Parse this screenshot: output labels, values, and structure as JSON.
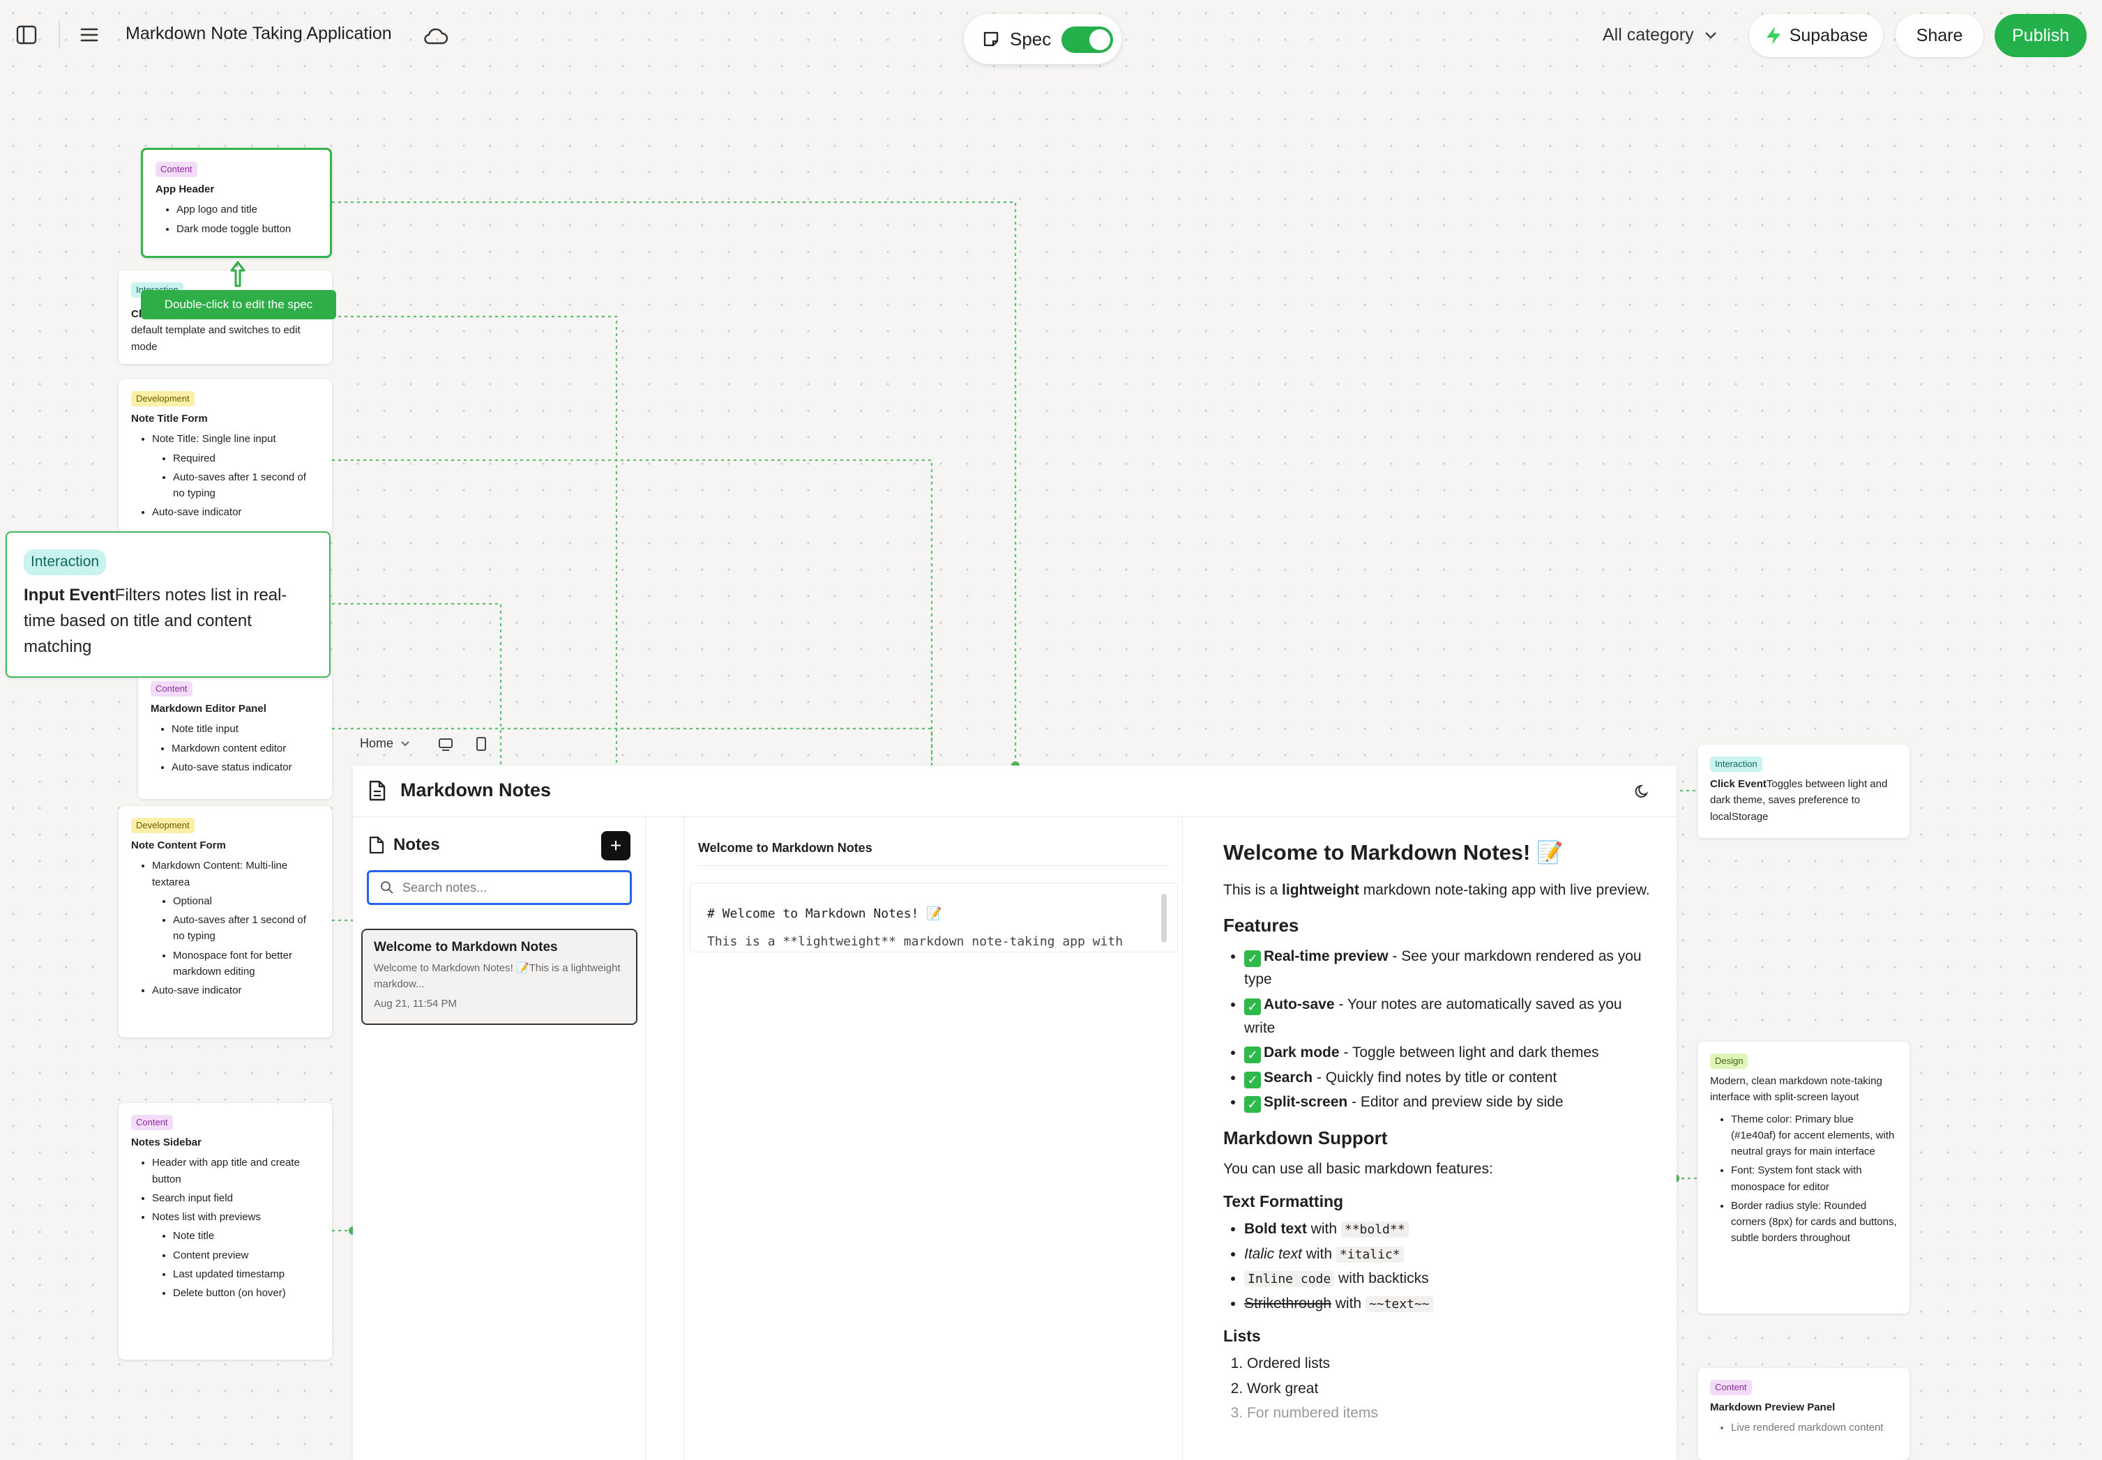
{
  "topbar": {
    "sidebar_toggle_icon": "sidebar-icon",
    "menu_icon": "hamburger-icon",
    "title": "Markdown Note Taking Application",
    "cloud_icon": "cloud-icon",
    "spec_label": "Spec",
    "spec_on": true,
    "category": "All category",
    "supabase": "Supabase",
    "share": "Share",
    "publish": "Publish",
    "accent": "#24b14b"
  },
  "tooltip": "Double-click to edit the spec",
  "cards": {
    "app_header": {
      "tag": "Content",
      "title": "App Header",
      "items": [
        "App logo and title",
        "Dark mode toggle button"
      ]
    },
    "click_template": {
      "tag": "Interaction",
      "title_start": "Cl",
      "text": "default template and switches to edit mode"
    },
    "note_title_form": {
      "tag": "Development",
      "title": "Note Title Form",
      "item1": "Note Title: Single line input",
      "sub1": "Required",
      "sub2": "Auto-saves after 1 second of no typing",
      "item2": "Auto-save indicator"
    },
    "input_event": {
      "tag": "Interaction",
      "bold": "Input Event",
      "text": "Filters notes list in real-time based on title and content matching"
    },
    "editor_panel": {
      "tag": "Content",
      "title": "Markdown Editor Panel",
      "items": [
        "Note title input",
        "Markdown content editor",
        "Auto-save status indicator"
      ]
    },
    "note_content_form": {
      "tag": "Development",
      "title": "Note Content Form",
      "item1": "Markdown Content: Multi-line textarea",
      "sub1": "Optional",
      "sub2": "Auto-saves after 1 second of no typing",
      "sub3": "Monospace font for better markdown editing",
      "item2": "Auto-save indicator"
    },
    "notes_sidebar": {
      "tag": "Content",
      "title": "Notes Sidebar",
      "item1": "Header with app title and create button",
      "item2": "Search input field",
      "item3": "Notes list with previews",
      "sub1": "Note title",
      "sub2": "Content preview",
      "sub3": "Last updated timestamp",
      "sub4": "Delete button (on hover)"
    },
    "dark_toggle": {
      "tag": "Interaction",
      "bold": "Click Event",
      "text": "Toggles between light and dark theme, saves preference to localStorage"
    },
    "design": {
      "tag": "Design",
      "text": "Modern, clean markdown note-taking interface with split-screen layout",
      "items": [
        "Theme color: Primary blue (#1e40af) for accent elements, with neutral grays for main interface",
        "Font: System font stack with monospace for editor",
        "Border radius style: Rounded corners (8px) for cards and buttons, subtle borders throughout"
      ]
    },
    "preview_panel": {
      "tag": "Content",
      "title": "Markdown Preview Panel",
      "item1": "Live rendered markdown content"
    }
  },
  "preview_toolbar": {
    "page": "Home",
    "desktop_icon": "monitor-icon",
    "mobile_icon": "phone-icon"
  },
  "app": {
    "title": "Markdown Notes",
    "doc_icon": "document-icon",
    "theme_icon": "moon-icon",
    "sidebar_title": "Notes",
    "search_placeholder": "Search notes...",
    "note": {
      "title": "Welcome to Markdown Notes",
      "preview": "Welcome to Markdown Notes! 📝This is a lightweight markdow...",
      "date": "Aug 21, 11:54 PM"
    },
    "editor_title": "Welcome to Markdown Notes",
    "editor_line1": "# Welcome to Markdown Notes! 📝",
    "editor_line2": "This is a **lightweight** markdown note-taking app with",
    "render": {
      "h1": "Welcome to Markdown Notes! 📝",
      "intro_a": "This is a ",
      "intro_b": "lightweight",
      "intro_c": " markdown note-taking app with live preview.",
      "features": "Features",
      "f1_b": "Real-time preview",
      "f1_t": " - See your markdown rendered as you type",
      "f2_b": "Auto-save",
      "f2_t": " - Your notes are automatically saved as you write",
      "f3_b": "Dark mode",
      "f3_t": " - Toggle between light and dark themes",
      "f4_b": "Search",
      "f4_t": " - Quickly find notes by title or content",
      "f5_b": "Split-screen",
      "f5_t": " - Editor and preview side by side",
      "support": "Markdown Support",
      "support_text": "You can use all basic markdown features:",
      "text_formatting": "Text Formatting",
      "t1_a": "Bold text",
      "t1_b": " with ",
      "t1_c": "**bold**",
      "t2_a": "Italic text",
      "t2_b": " with ",
      "t2_c": "*italic*",
      "t3_a": "Inline code",
      "t3_b": " with backticks",
      "t4_a": "Strikethrough",
      "t4_b": " with ",
      "t4_c": "~~text~~",
      "lists": "Lists",
      "l1": "Ordered lists",
      "l2": "Work great",
      "l3": "For numbered items"
    }
  }
}
